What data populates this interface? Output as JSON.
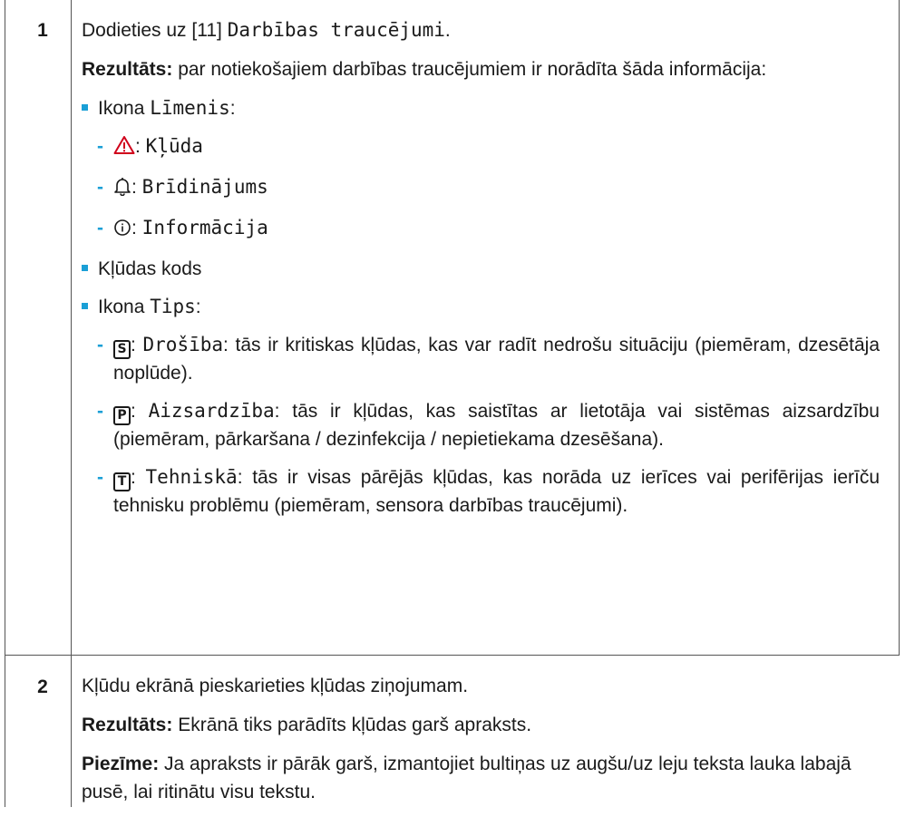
{
  "step1": {
    "number": "1",
    "intro_before": "Dodieties uz [11] ",
    "intro_code": "Darbības traucējumi",
    "intro_after": ".",
    "result_label": "Rezultāts:",
    "result_text": " par notiekošajiem darbības traucējumiem ir norādīta šāda informācija:",
    "level_prefix": "Ikona ",
    "level_code": "Līmenis",
    "level_suffix": ":",
    "levels": [
      {
        "icon": "warning-triangle-icon",
        "sep": ": ",
        "label": "Kļūda"
      },
      {
        "icon": "bell-icon",
        "sep": ": ",
        "label": "Brīdinājums"
      },
      {
        "icon": "info-circle-icon",
        "sep": ": ",
        "label": "Informācija"
      }
    ],
    "error_code_item": "Kļūdas kods",
    "type_prefix": "Ikona ",
    "type_code": "Tips",
    "type_suffix": ":",
    "types": [
      {
        "letter": "S",
        "sep": ": ",
        "label": "Drošība",
        "desc": ": tās ir kritiskas kļūdas, kas var radīt nedrošu situāciju (piemēram, dzesētāja noplūde)."
      },
      {
        "letter": "P",
        "sep": ": ",
        "label": "Aizsardzība",
        "desc": ": tās ir kļūdas, kas saistītas ar lietotāja vai sistēmas aizsardzību (piemēram, pārkaršana / dezinfekcija / nepietiekama dzesēšana)."
      },
      {
        "letter": "T",
        "sep": ": ",
        "label": "Tehniskā",
        "desc": ": tās ir visas pārējās kļūdas, kas norāda uz ierīces vai perifērijas ierīču tehnisku problēmu (piemēram, sensora darbības traucējumi)."
      }
    ]
  },
  "step2": {
    "number": "2",
    "instruction": "Kļūdu ekrānā pieskarieties kļūdas ziņojumam.",
    "result_label": "Rezultāts:",
    "result_text": " Ekrānā tiks parādīts kļūdas garš apraksts.",
    "note_label": "Piezīme:",
    "note_text": " Ja apraksts ir pārāk garš, izmantojiet bultiņas uz augšu/uz leju teksta lauka labajā pusē, lai ritinātu visu tekstu."
  },
  "colors": {
    "bullet": "#1a9fd6",
    "warning": "#d0021b",
    "border": "#555555"
  }
}
